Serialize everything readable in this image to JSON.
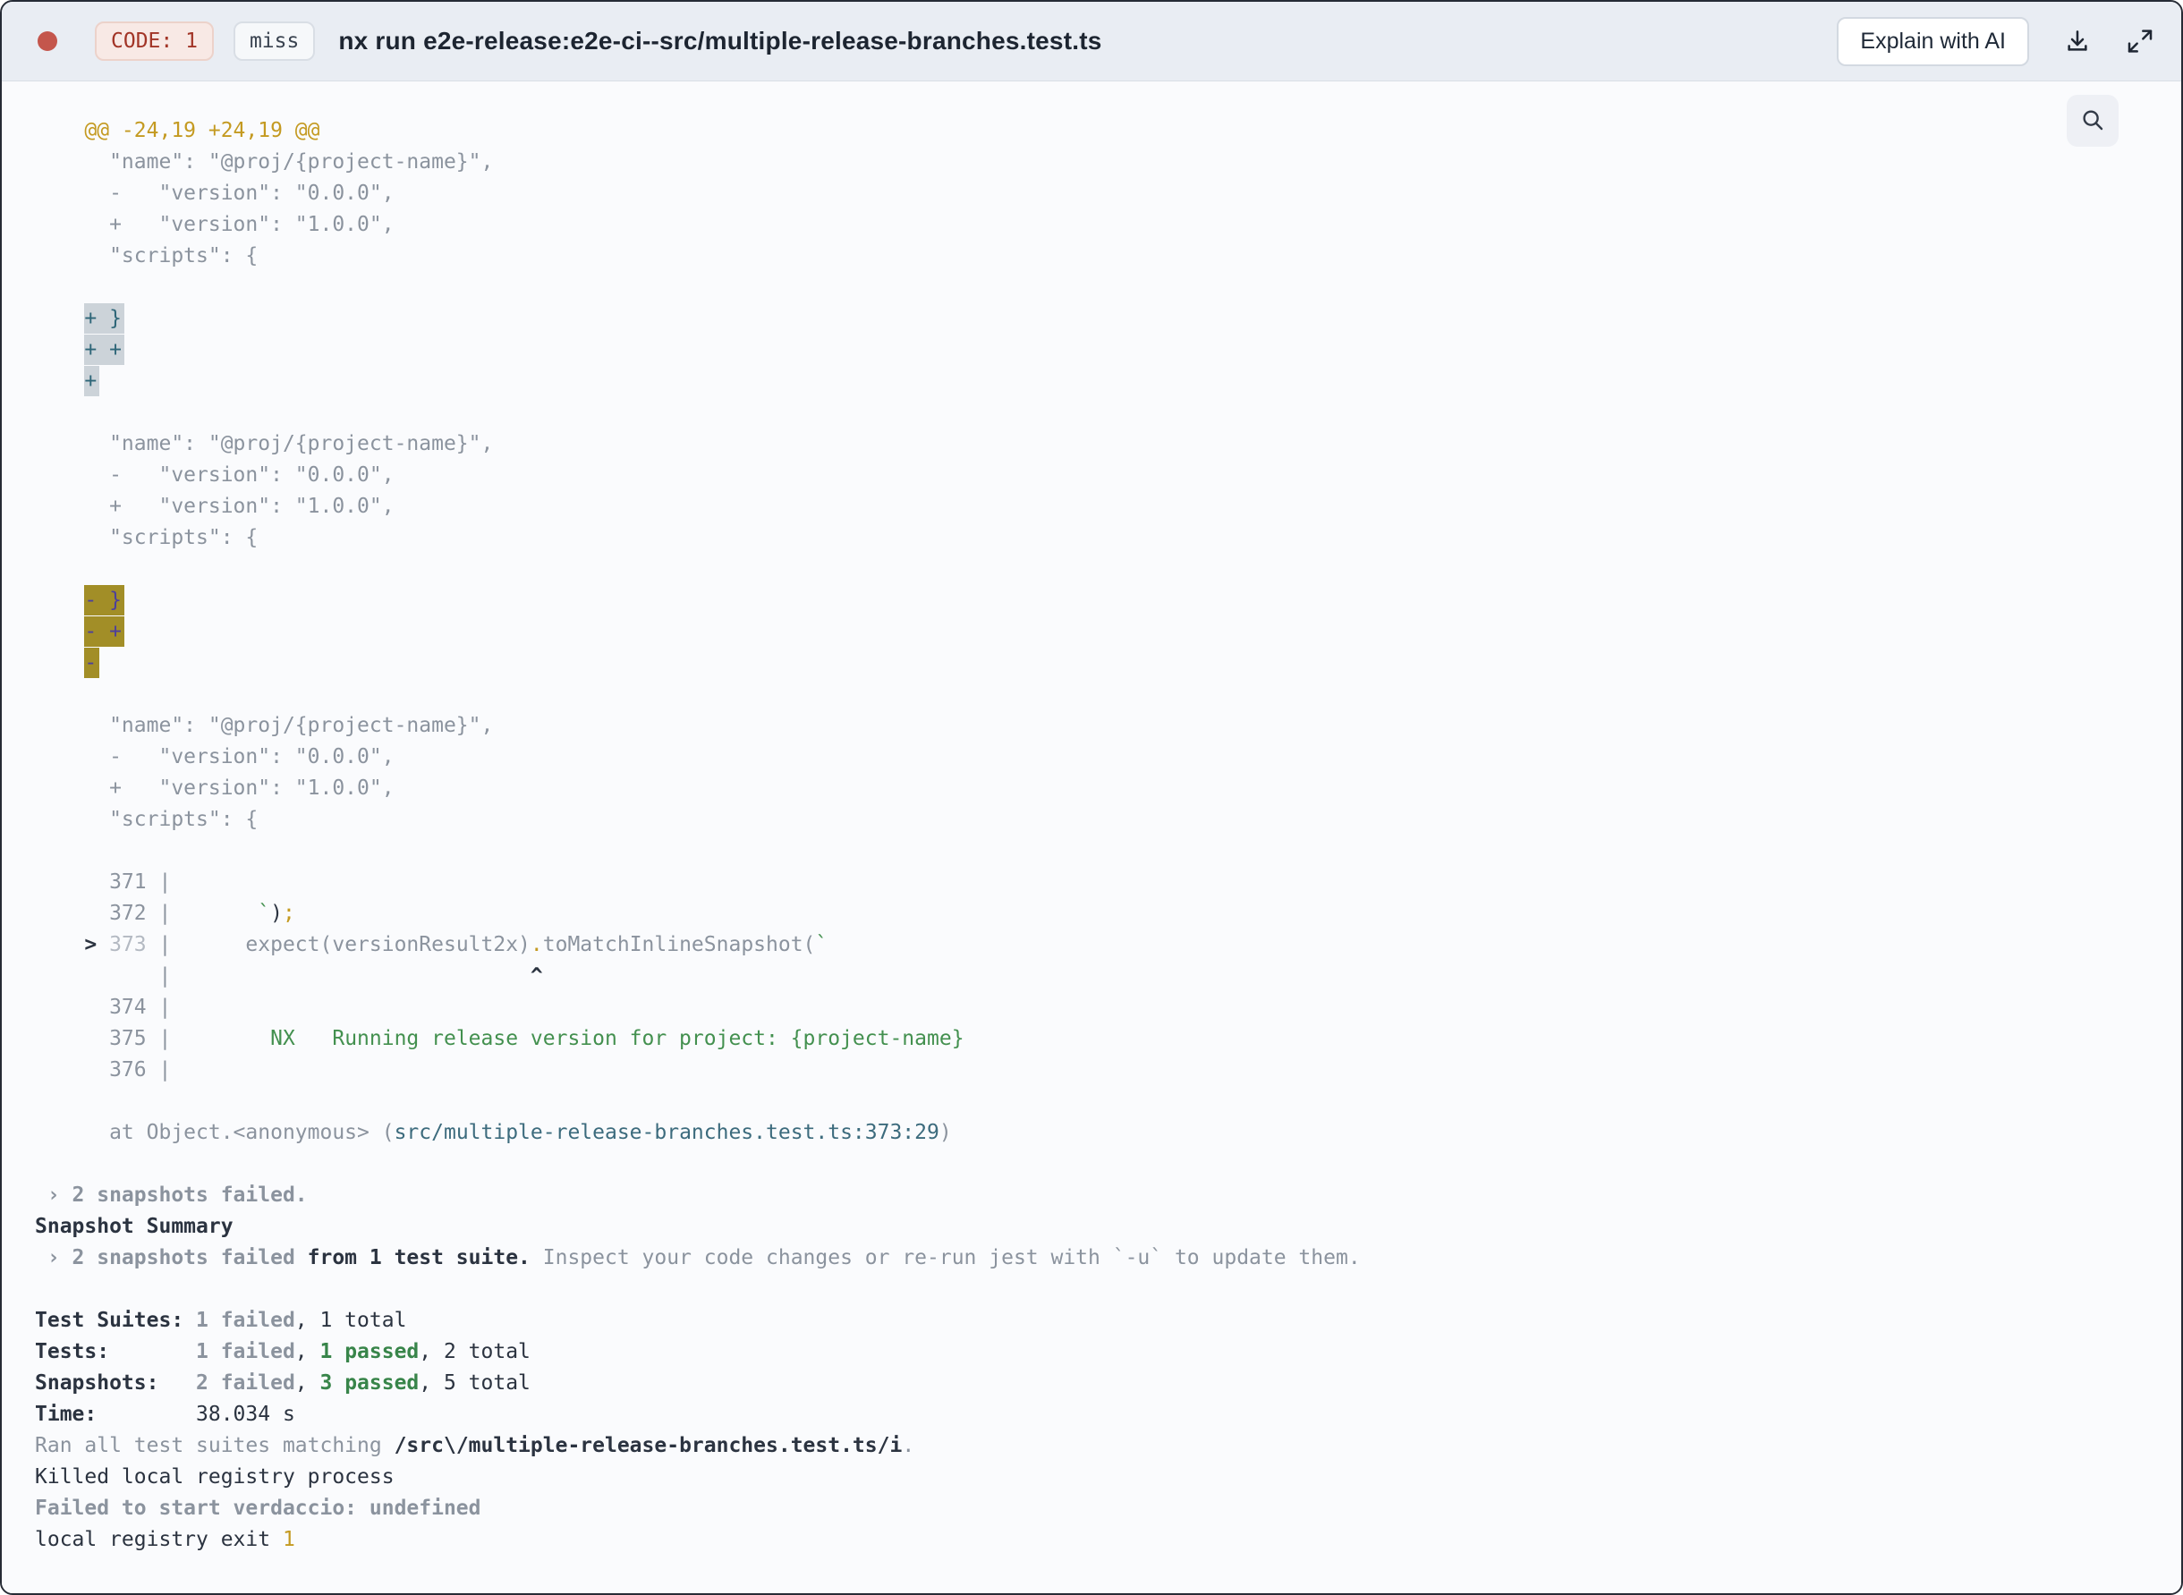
{
  "header": {
    "code_badge": "CODE: 1",
    "miss_badge": "miss",
    "title": "nx run e2e-release:e2e-ci--src/multiple-release-branches.test.ts",
    "explain_button": "Explain with AI"
  },
  "colors": {
    "status_dot": "#c4564c",
    "hunk_gold": "#c49a21",
    "diff_dim": "#8b939e",
    "foreground_dark": "#2b3340",
    "string_green": "#43904f",
    "passed_green": "#38854a",
    "location_teal": "#3c6b7d",
    "selection_bg": "#ccd3d9",
    "selection_fg": "#2e6678",
    "search_match_bg": "#a28e27",
    "search_match_fg": "#4c3f9d"
  },
  "terminal": {
    "lines": [
      [
        [
          "gold",
          "    @@ -24,19 +24,19 @@"
        ]
      ],
      [
        [
          "dim",
          "      \"name\": \"@proj/{project-name}\","
        ]
      ],
      [
        [
          "dim",
          "      -   \"version\": \"0.0.0\","
        ]
      ],
      [
        [
          "dim",
          "      +   \"version\": \"1.0.0\","
        ]
      ],
      [
        [
          "dim",
          "      \"scripts\": {"
        ]
      ],
      [],
      [
        [
          "dim",
          "    "
        ],
        [
          "sel",
          "+ }"
        ]
      ],
      [
        [
          "dim",
          "    "
        ],
        [
          "sel",
          "+ +"
        ]
      ],
      [
        [
          "dim",
          "    "
        ],
        [
          "sel",
          "+"
        ]
      ],
      [],
      [
        [
          "dim",
          "      \"name\": \"@proj/{project-name}\","
        ]
      ],
      [
        [
          "dim",
          "      -   \"version\": \"0.0.0\","
        ]
      ],
      [
        [
          "dim",
          "      +   \"version\": \"1.0.0\","
        ]
      ],
      [
        [
          "dim",
          "      \"scripts\": {"
        ]
      ],
      [],
      [
        [
          "dim",
          "    "
        ],
        [
          "match",
          "- }"
        ]
      ],
      [
        [
          "dim",
          "    "
        ],
        [
          "match",
          "- +"
        ]
      ],
      [
        [
          "dim",
          "    "
        ],
        [
          "match",
          "-"
        ]
      ],
      [],
      [
        [
          "dim",
          "      \"name\": \"@proj/{project-name}\","
        ]
      ],
      [
        [
          "dim",
          "      -   \"version\": \"0.0.0\","
        ]
      ],
      [
        [
          "dim",
          "      +   \"version\": \"1.0.0\","
        ]
      ],
      [
        [
          "dim",
          "      \"scripts\": {"
        ]
      ],
      [],
      [
        [
          "dim",
          "      371 |"
        ]
      ],
      [
        [
          "dim",
          "      372 |       "
        ],
        [
          "green",
          "`"
        ],
        [
          "fg",
          ")"
        ],
        [
          "gold",
          ";"
        ]
      ],
      [
        [
          "fgB",
          "    > "
        ],
        [
          "numDim",
          "373"
        ],
        [
          "dim",
          " |      expect(versionResult2x)"
        ],
        [
          "gold",
          "."
        ],
        [
          "dim",
          "toMatchInlineSnapshot("
        ],
        [
          "green",
          "`"
        ]
      ],
      [
        [
          "dim",
          "          |"
        ],
        [
          "fgB",
          "                             ^"
        ]
      ],
      [
        [
          "dim",
          "      374 |"
        ]
      ],
      [
        [
          "dim",
          "      375 |"
        ],
        [
          "green",
          "        NX   Running release version for project: {project-name}"
        ]
      ],
      [
        [
          "dim",
          "      376 |"
        ]
      ],
      [],
      [
        [
          "dim",
          "      at Object.<anonymous> ("
        ],
        [
          "loc",
          "src/multiple-release-branches.test.ts:373:29"
        ],
        [
          "dim",
          ")"
        ]
      ],
      [],
      [
        [
          "dimB",
          " › 2 snapshots failed."
        ]
      ],
      [
        [
          "fgB",
          "Snapshot Summary"
        ]
      ],
      [
        [
          "dimB",
          " › 2 snapshots failed"
        ],
        [
          "fgB",
          " from 1 test suite."
        ],
        [
          "dim",
          " Inspect your code changes or re-run jest with `-u` to update them."
        ]
      ],
      [],
      [
        [
          "fgB",
          "Test Suites: "
        ],
        [
          "dimB",
          "1 failed"
        ],
        [
          "fg",
          ", 1 total"
        ]
      ],
      [
        [
          "fgB",
          "Tests:       "
        ],
        [
          "dimB",
          "1 failed"
        ],
        [
          "fg",
          ", "
        ],
        [
          "greenB",
          "1 passed"
        ],
        [
          "fg",
          ", 2 total"
        ]
      ],
      [
        [
          "fgB",
          "Snapshots:   "
        ],
        [
          "dimB",
          "2 failed"
        ],
        [
          "fg",
          ", "
        ],
        [
          "greenB",
          "3 passed"
        ],
        [
          "fg",
          ", 5 total"
        ]
      ],
      [
        [
          "fgB",
          "Time:        "
        ],
        [
          "fg",
          "38.034 s"
        ]
      ],
      [
        [
          "dim",
          "Ran all test suites matching "
        ],
        [
          "fgB",
          "/src\\/multiple-release-branches.test.ts/i"
        ],
        [
          "dim",
          "."
        ]
      ],
      [
        [
          "fg",
          "Killed local registry process"
        ]
      ],
      [
        [
          "dimB",
          "Failed to start verdaccio: undefined"
        ]
      ],
      [
        [
          "fg",
          "local registry exit "
        ],
        [
          "gold",
          "1"
        ]
      ]
    ]
  }
}
